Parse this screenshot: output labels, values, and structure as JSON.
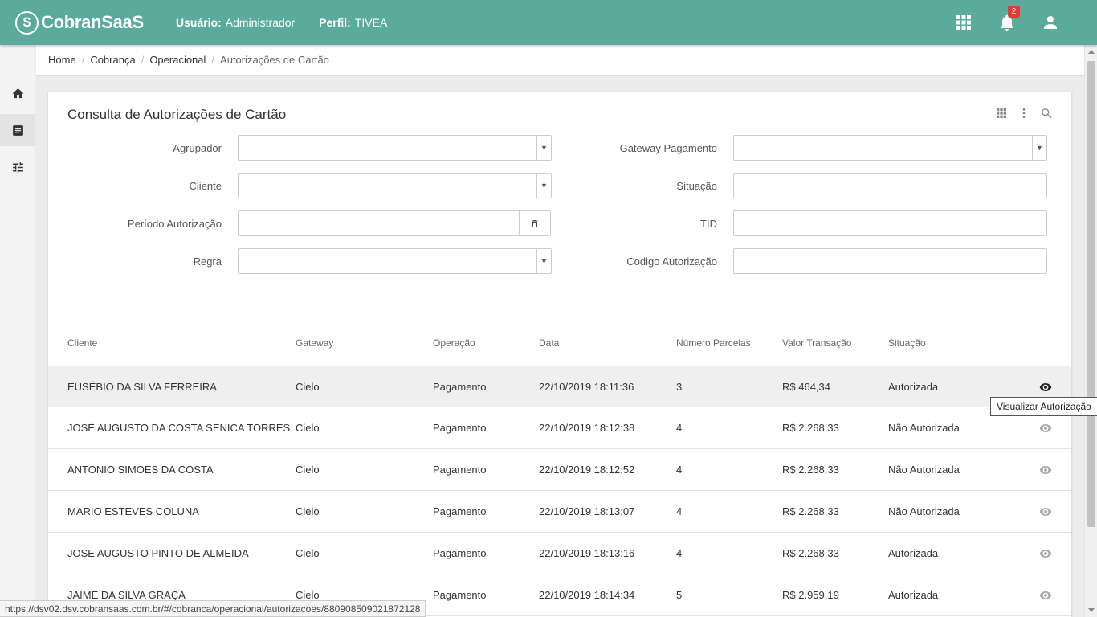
{
  "header": {
    "logo_text": "CobranSaaS",
    "logo_mark": "$",
    "usuario_label": "Usuário:",
    "usuario_value": "Administrador",
    "perfil_label": "Perfil:",
    "perfil_value": "TIVEA",
    "notification_count": "2",
    "icons": [
      "apps-grid-icon",
      "bell-icon",
      "user-icon"
    ]
  },
  "sidebar": {
    "items": [
      "home-icon",
      "clipboard-icon",
      "sliders-icon"
    ]
  },
  "breadcrumb": {
    "items": [
      "Home",
      "Cobrança",
      "Operacional"
    ],
    "current": "Autorizações de Cartão"
  },
  "card": {
    "title": "Consulta de Autorizações de Cartão"
  },
  "form": {
    "agrupador": "Agrupador",
    "cliente": "Cliente",
    "periodo": "Período Autorização",
    "regra": "Regra",
    "gateway": "Gateway Pagamento",
    "situacao": "Situação",
    "tid": "TID",
    "codigo": "Codigo Autorização"
  },
  "table": {
    "columns": [
      "Cliente",
      "Gateway",
      "Operação",
      "Data",
      "Número Parcelas",
      "Valor Transação",
      "Situação"
    ],
    "rows": [
      [
        "EUSÉBIO DA SILVA FERREIRA",
        "Cielo",
        "Pagamento",
        "22/10/2019 18:11:36",
        "3",
        "R$ 464,34",
        "Autorizada"
      ],
      [
        "JOSÉ AUGUSTO DA COSTA SENICA TORRES",
        "Cielo",
        "Pagamento",
        "22/10/2019 18:12:38",
        "4",
        "R$ 2.268,33",
        "Não Autorizada"
      ],
      [
        "ANTONIO SIMOES DA COSTA",
        "Cielo",
        "Pagamento",
        "22/10/2019 18:12:52",
        "4",
        "R$ 2.268,33",
        "Não Autorizada"
      ],
      [
        "MARIO ESTEVES COLUNA",
        "Cielo",
        "Pagamento",
        "22/10/2019 18:13:07",
        "4",
        "R$ 2.268,33",
        "Não Autorizada"
      ],
      [
        "JOSE AUGUSTO PINTO DE ALMEIDA",
        "Cielo",
        "Pagamento",
        "22/10/2019 18:13:16",
        "4",
        "R$ 2.268,33",
        "Autorizada"
      ],
      [
        "JAIME DA SILVA GRAÇA",
        "Cielo",
        "Pagamento",
        "22/10/2019 18:14:34",
        "5",
        "R$ 2.959,19",
        "Autorizada"
      ]
    ]
  },
  "tooltip": "Visualizar Autorização",
  "status_url": "https://dsv02.dsv.cobransaas.com.br/#/cobranca/operacional/autorizacoes/880908509021872128"
}
